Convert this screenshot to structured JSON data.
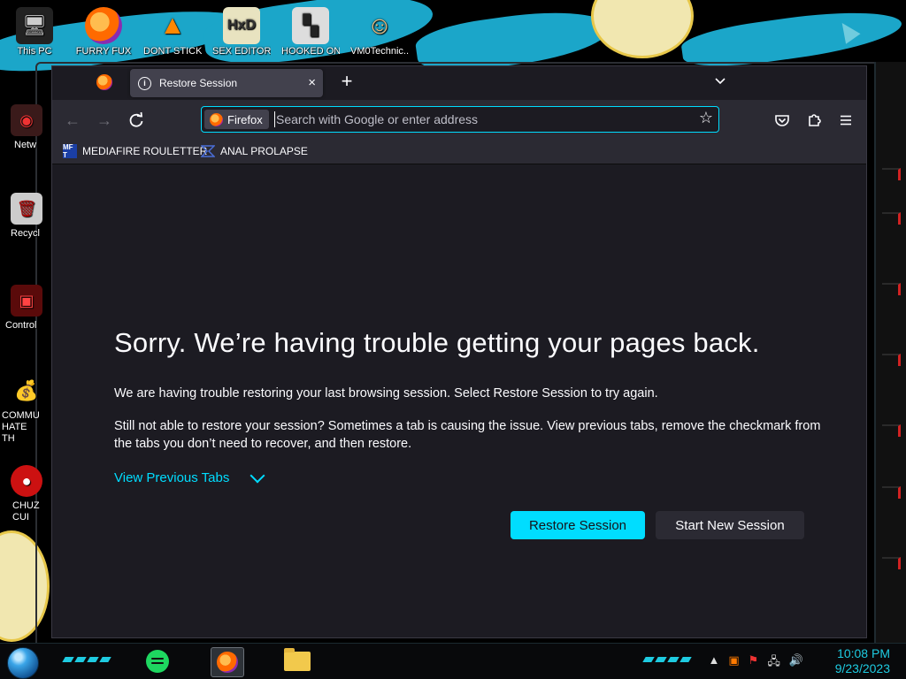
{
  "desktop": {
    "top_icons": [
      {
        "label": "This PC"
      },
      {
        "label": "FURRY FUX"
      },
      {
        "label": "DONT STICK"
      },
      {
        "label": "SEX EDITOR"
      },
      {
        "label": "HOOKED ON"
      },
      {
        "label": "VM0Technic..."
      }
    ],
    "left_icons": [
      {
        "label": "Netw"
      },
      {
        "label": "Recycl"
      },
      {
        "label": "Control"
      },
      {
        "label": "COMMU HATE TH"
      },
      {
        "label": "CHUZ CUI"
      }
    ]
  },
  "browser": {
    "tab": {
      "title": "Restore Session",
      "new_tab_symbol": "+",
      "close_symbol": "×"
    },
    "urlbar": {
      "identity_label": "Firefox",
      "placeholder": "Search with Google or enter address",
      "value": ""
    },
    "bookmarks": [
      {
        "label": "MEDIAFIRE ROULETTER",
        "icon_text": "MF T"
      },
      {
        "label": "ANAL PROLAPSE",
        "icon_text": ""
      }
    ],
    "page": {
      "heading": "Sorry. We’re having trouble getting your pages back.",
      "paragraph_1": "We are having trouble restoring your last browsing session. Select Restore Session to try again.",
      "paragraph_2": "Still not able to restore your session? Sometimes a tab is causing the issue. View previous tabs, remove the checkmark from the tabs you don’t need to recover, and then restore.",
      "view_previous_tabs": "View Previous Tabs",
      "restore_button": "Restore Session",
      "new_session_button": "Start New Session"
    }
  },
  "taskbar": {
    "time": "10:08 PM",
    "date": "9/23/2023"
  },
  "colors": {
    "accent": "#00ddff",
    "window_bg": "#1c1b22",
    "toolbar_bg": "#2b2a33",
    "tab_bg": "#42414d",
    "text": "#fbfbfe",
    "wallpaper_blue": "#1ba6c9"
  }
}
